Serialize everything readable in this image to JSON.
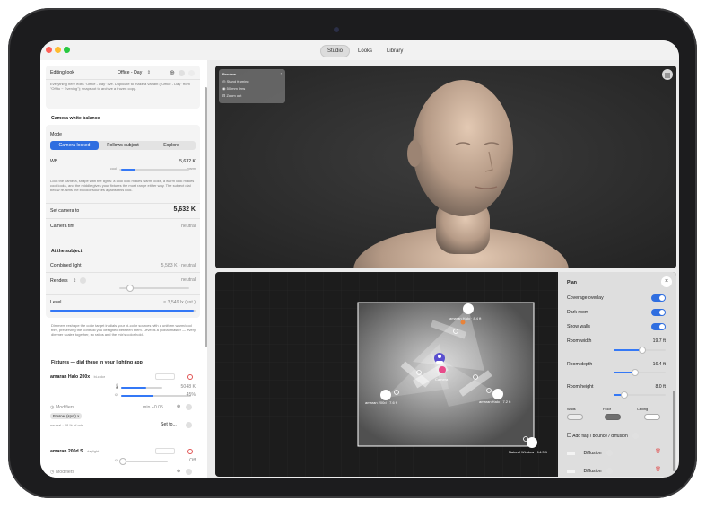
{
  "tabs": {
    "studio": "Studio",
    "looks": "Looks",
    "library": "Library"
  },
  "look": {
    "label": "Editing look",
    "value": "Office - Day",
    "desc": "Everything here edits \"Office - Day\" live. Duplicate to make a variant (\"Office - Day\" from \"Off to ~ Evening\"); snapshot to archive a frozen copy."
  },
  "cwb": {
    "heading": "Camera white balance",
    "mode_label": "Mode",
    "modes": [
      "Camera locked",
      "Follows subject",
      "Explore"
    ],
    "wb_label": "WB",
    "wb_value": "5,632 K",
    "scale_low": "cool",
    "scale_high": "warm",
    "desc": "Lock the camera, shape with the lights: a cool look makes warm looks, a warm look makes cool looks, and the middle gives your fixtures the most range either way. The subject dial below re-aims the bi-color sources against this lock.",
    "set_label": "Set camera to",
    "set_value": "5,632 K",
    "tint_label": "Camera tint",
    "tint_value": "neutral"
  },
  "subject": {
    "heading": "At the subject",
    "combined_label": "Combined light",
    "combined_value": "5,583 K · neutral",
    "renders_label": "Renders",
    "renders_value": "neutral",
    "level_label": "Level",
    "level_value": "≈ 3,549 lx (est.)",
    "desc": "Dimmers reshape the color target in-dials your bi-color sources with a uniform warm/cool trim, preserving the contrast you designed between them. Level is a global master — every dimmer scales together, so ratios and the mix's color hold."
  },
  "fixtures": {
    "heading": "Fixtures — dial these in your lighting app",
    "items": [
      {
        "name": "amaran Halo 200x",
        "sub": "bi-color",
        "cct": "5048 K",
        "pct": "45%",
        "modifiers": "Modifiers",
        "tag": "Fresnel (spot)",
        "ev": "min +0.05",
        "neutral": "neutral · 48 % of mix",
        "set_to": "Set to..."
      },
      {
        "name": "amaran 200d S",
        "sub": "daylight",
        "pct": "Off",
        "modifiers": "Modifiers"
      }
    ]
  },
  "preview": {
    "title": "Preview",
    "items": [
      "Stand framing",
      "50 mm lens",
      "Zoom out"
    ]
  },
  "plan": {
    "lights": [
      {
        "label": "amaran Halo · 8.4 ft"
      },
      {
        "label": "amaran 200d · 7.6 ft"
      },
      {
        "label": "amaran Halo · 7.2 ft"
      },
      {
        "label": "Natural Window · 14.3 ft"
      }
    ],
    "camera_label": "Camera"
  },
  "panel": {
    "title": "Plan",
    "coverage": "Coverage overlay",
    "dark": "Dark room",
    "walls": "Show walls",
    "width_label": "Room width",
    "width_value": "19.7 ft",
    "width_level": 0.55,
    "depth_label": "Room depth",
    "depth_value": "16.4 ft",
    "depth_level": 0.42,
    "height_label": "Room height",
    "height_value": "8.0 ft",
    "height_level": 0.2,
    "surfaces": [
      "Walls",
      "Floor",
      "Ceiling"
    ],
    "add_flag": "Add flag / bounce / diffusion",
    "diffusions": [
      "Diffusion",
      "Diffusion"
    ]
  },
  "colors": {
    "accent": "#2f6ee0",
    "orange": "#e8833a",
    "purple": "#5a4fcf"
  }
}
